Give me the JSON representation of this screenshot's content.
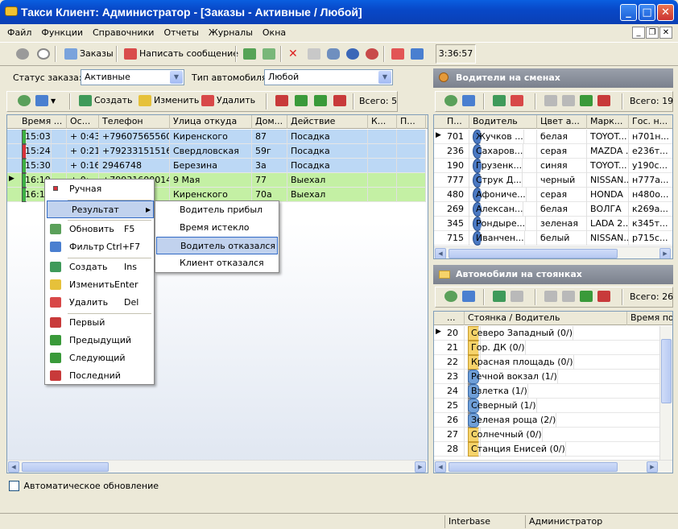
{
  "window": {
    "title": "Такси Клиент: Администратор - [Заказы - Активные / Любой]",
    "min": "_",
    "max": "□",
    "close": "✕"
  },
  "menu": [
    "Файл",
    "Функции",
    "Справочники",
    "Отчеты",
    "Журналы",
    "Окна"
  ],
  "mdi": {
    "min": "_",
    "restore": "❐",
    "close": "✕"
  },
  "toolbar": {
    "orders": "Заказы",
    "message": "Написать сообщение",
    "clock": "3:36:57"
  },
  "filters": {
    "status_label": "Статус заказа:",
    "status_value": "Активные",
    "car_label": "Тип автомобиля:",
    "car_value": "Любой"
  },
  "orders_toolbar": {
    "create": "Создать",
    "edit": "Изменить",
    "delete": "Удалить",
    "total": "Всего: 5"
  },
  "orders": {
    "columns": [
      "Время ...",
      "Ос...",
      "Телефон",
      "Улица откуда",
      "Дом...",
      "Действие",
      "К...",
      "П..."
    ],
    "rows": [
      {
        "time": "15:03",
        "left": "+ 0:43",
        "phone": "+79607565560",
        "street": "Киренского",
        "house": "87",
        "action": "Посадка",
        "color": "blue",
        "mark": "#3cb043"
      },
      {
        "time": "15:24",
        "left": "+ 0:21",
        "phone": "+79233151516",
        "street": "Свердловская",
        "house": "59г",
        "action": "Посадка",
        "color": "blue",
        "mark": "#d8323c"
      },
      {
        "time": "15:30",
        "left": "+ 0:16",
        "phone": "2946748",
        "street": "Березина",
        "house": "3а",
        "action": "Посадка",
        "color": "blue",
        "mark": "#3cb043"
      },
      {
        "time": "16:10",
        "left": "+ 0:...",
        "phone": "+79931600014",
        "street": "9 Мая",
        "house": "77",
        "action": "Выехал",
        "color": "green",
        "mark": "#3cb043"
      },
      {
        "time": "16:15",
        "left": "",
        "phone": "...9005",
        "street": "Киренского",
        "house": "70а",
        "action": "Выехал",
        "color": "green",
        "mark": "#3cb043"
      }
    ]
  },
  "auto_update": "Автоматическое обновление",
  "context_menu": {
    "items": [
      {
        "label": "Ручная",
        "key": ""
      },
      {
        "label": "Результат",
        "key": ""
      },
      {
        "label": "Обновить",
        "key": "F5"
      },
      {
        "label": "Фильтр",
        "key": "Ctrl+F7"
      },
      {
        "label": "Создать",
        "key": "Ins"
      },
      {
        "label": "Изменить",
        "key": "Enter"
      },
      {
        "label": "Удалить",
        "key": "Del"
      },
      {
        "label": "Первый",
        "key": ""
      },
      {
        "label": "Предыдущий",
        "key": ""
      },
      {
        "label": "Следующий",
        "key": ""
      },
      {
        "label": "Последний",
        "key": ""
      }
    ],
    "submenu": [
      "Водитель прибыл",
      "Время истекло",
      "Водитель отказался",
      "Клиент отказался"
    ]
  },
  "drivers": {
    "title": "Водители на сменах",
    "total": "Всего: 19",
    "columns": [
      "П...",
      "Водитель",
      "Цвет а...",
      "Марк...",
      "Гос. н..."
    ],
    "rows": [
      [
        "701",
        "Жучков ...",
        "белая",
        "TOYOT...",
        "н701н..."
      ],
      [
        "236",
        "Сахаров...",
        "серая",
        "MAZDA ...",
        "е236т..."
      ],
      [
        "190",
        "Грузенк...",
        "синяя",
        "TOYOT...",
        "у190с..."
      ],
      [
        "777",
        "Струк Д...",
        "черный",
        "NISSAN...",
        "н777а..."
      ],
      [
        "480",
        "Афониче...",
        "серая",
        "HONDA",
        "н480о..."
      ],
      [
        "269",
        "Алексан...",
        "белая",
        "ВОЛГА",
        "к269а..."
      ],
      [
        "345",
        "Рондыре...",
        "зеленая",
        "LADA 2...",
        "к345т..."
      ],
      [
        "715",
        "Иванчен...",
        "белый",
        "NISSAN...",
        "р715с..."
      ]
    ]
  },
  "parkings": {
    "title": "Автомобили на стоянках",
    "total": "Всего: 26",
    "columns": [
      "...",
      "Стоянка / Водитель",
      "Время пос..."
    ],
    "rows": [
      {
        "n": "20",
        "name": "Северо Западный (0/)",
        "plus": false
      },
      {
        "n": "21",
        "name": "Гор. ДК (0/)",
        "plus": false
      },
      {
        "n": "22",
        "name": "Красная площадь (0/)",
        "plus": false
      },
      {
        "n": "23",
        "name": "Речной вокзал (1/)",
        "plus": true
      },
      {
        "n": "24",
        "name": "Взлетка (1/)",
        "plus": true
      },
      {
        "n": "25",
        "name": "Северный (1/)",
        "plus": true
      },
      {
        "n": "26",
        "name": "Зеленая роща (2/)",
        "plus": true
      },
      {
        "n": "27",
        "name": "Солнечный (0/)",
        "plus": false
      },
      {
        "n": "28",
        "name": "Станция Енисей (0/)",
        "plus": false
      }
    ]
  },
  "status": {
    "db": "Interbase",
    "user": "Администратор"
  }
}
